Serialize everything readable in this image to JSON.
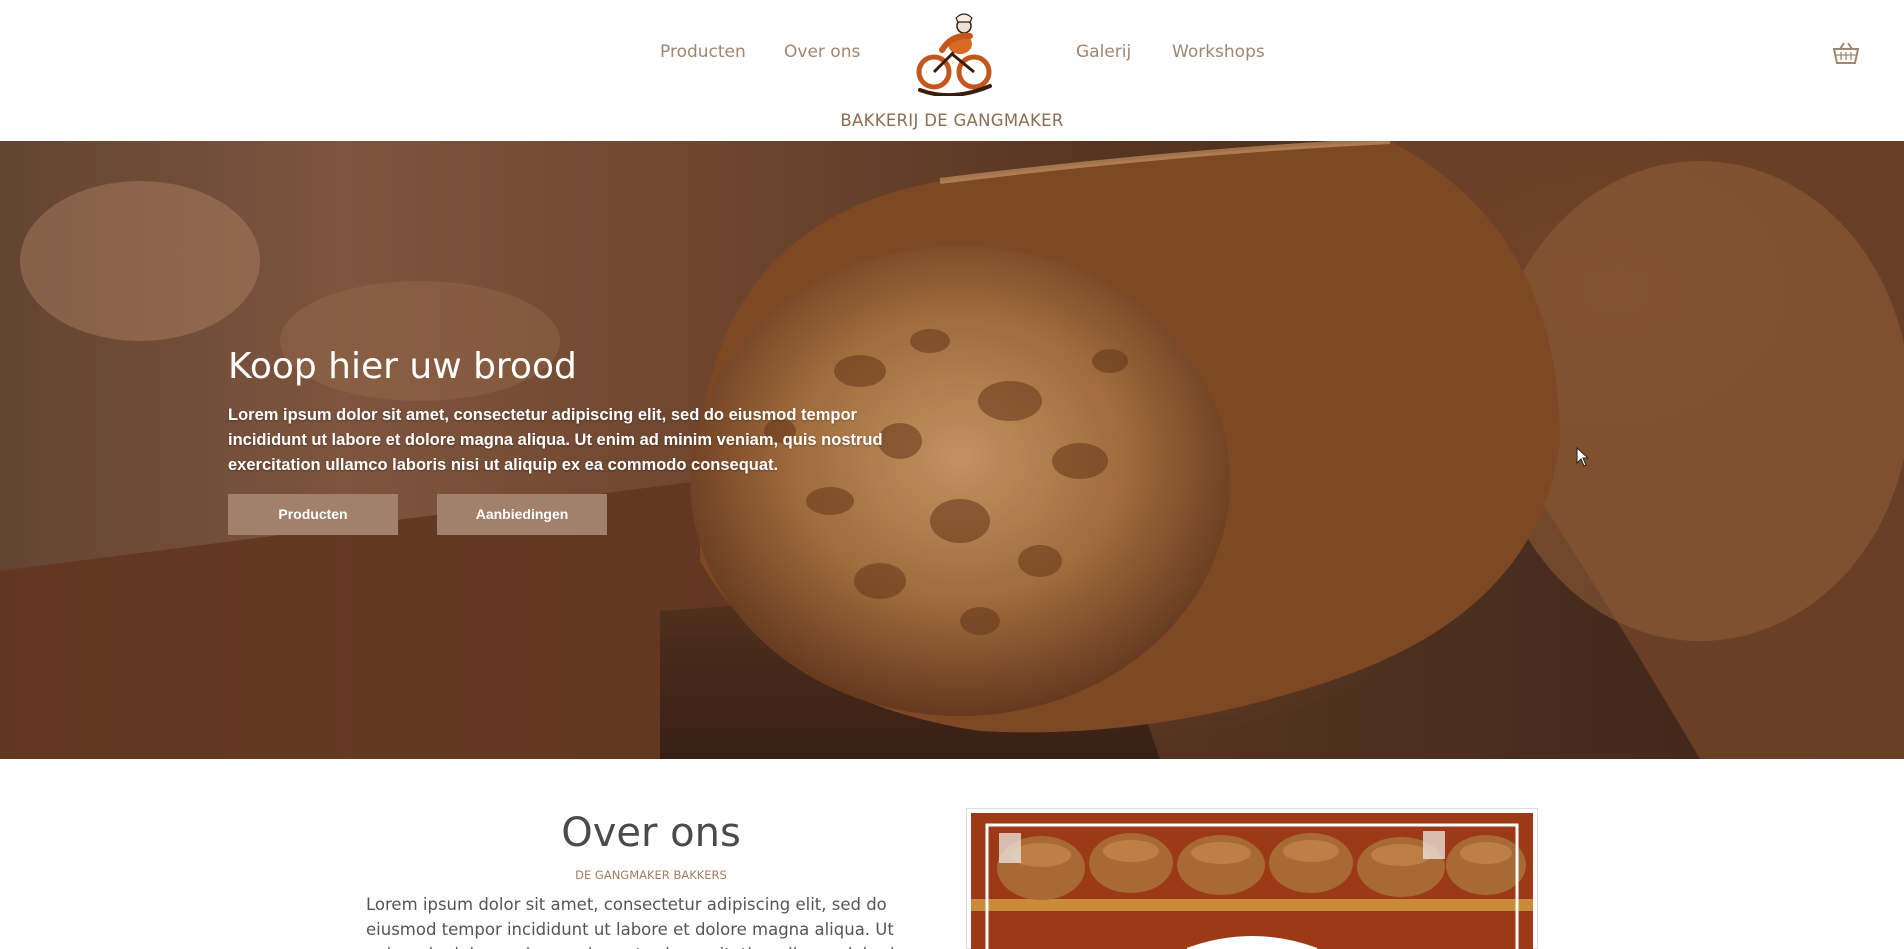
{
  "header": {
    "nav_left": [
      "Producten",
      "Over ons"
    ],
    "nav_right": [
      "Galerij",
      "Workshops"
    ],
    "brand": "BAKKERIJ DE GANGMAKER",
    "logo_icon": "cyclist-baker-logo",
    "cart_icon": "basket-icon"
  },
  "hero": {
    "title": "Koop hier uw brood",
    "text": "Lorem ipsum dolor sit amet, consectetur adipiscing elit, sed do eiusmod tempor incididunt ut labore et dolore magna aliqua. Ut enim ad minim veniam, quis nostrud exercitation ullamco laboris nisi ut aliquip ex ea commodo consequat.",
    "buttons": [
      "Producten",
      "Aanbiedingen"
    ]
  },
  "about": {
    "title": "Over ons",
    "subtitle": "DE GANGMAKER BAKKERS",
    "text": "Lorem ipsum dolor sit amet, consectetur adipiscing elit, sed do eiusmod tempor incididunt ut labore et dolore magna aliqua. Ut enim ad minim veniam, quis nostrud exercitation ullamco laboris nisi ut aliquip ex ea commodo consequat."
  },
  "colors": {
    "accent": "#a1806c",
    "brand_text": "#8b6e52",
    "nav_text": "#a08670"
  }
}
